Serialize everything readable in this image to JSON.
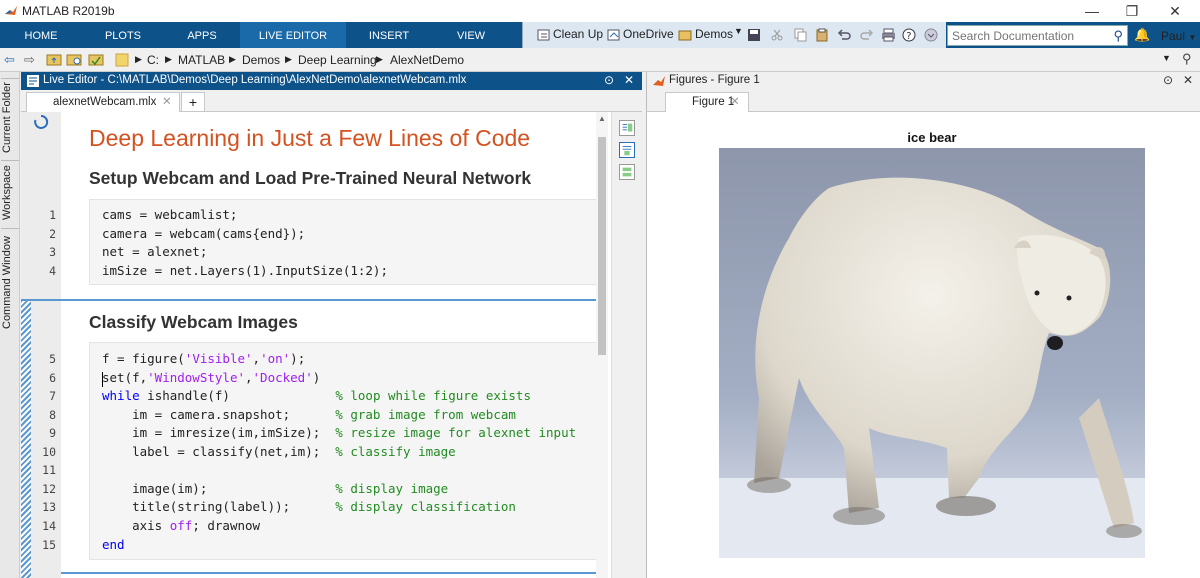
{
  "app": {
    "title": "MATLAB R2019b"
  },
  "window_controls": {
    "minimize": "—",
    "restore": "❐",
    "close": "✕"
  },
  "ribbon": {
    "tabs": [
      "HOME",
      "PLOTS",
      "APPS",
      "LIVE EDITOR",
      "INSERT",
      "VIEW"
    ],
    "active_tab": "LIVE EDITOR",
    "quick_access": {
      "clean_up": "Clean Up",
      "onedrive": "OneDrive",
      "demos": "Demos"
    },
    "search_placeholder": "Search Documentation",
    "user": "Paul"
  },
  "address": {
    "crumbs": [
      "C:",
      "MATLAB",
      "Demos",
      "Deep Learning",
      "AlexNetDemo"
    ]
  },
  "side_tabs": [
    "Current Folder",
    "Workspace",
    "Command Window"
  ],
  "live_editor": {
    "header": "Live Editor - C:\\MATLAB\\Demos\\Deep Learning\\AlexNetDemo\\alexnetWebcam.mlx",
    "file_tab": "alexnetWebcam.mlx",
    "add_tab": "+",
    "heading1": "Deep Learning in Just a Few Lines of Code",
    "section1_title": "Setup Webcam and Load Pre-Trained Neural Network",
    "section2_title": "Classify Webcam Images",
    "line_numbers": [
      "1",
      "2",
      "3",
      "4",
      "5",
      "6",
      "7",
      "8",
      "9",
      "10",
      "11",
      "12",
      "13",
      "14",
      "15"
    ],
    "code": {
      "l1": "cams = webcamlist;",
      "l2": "camera = webcam(cams{end});",
      "l3": "net = alexnet;",
      "l4": "imSize = net.Layers(1).InputSize(1:2);",
      "l5a": "f = figure(",
      "l5b": "'Visible'",
      "l5c": ",",
      "l5d": "'on'",
      "l5e": ");",
      "l6a": "set(f,",
      "l6b": "'WindowStyle'",
      "l6c": ",",
      "l6d": "'Docked'",
      "l6e": ")",
      "l7a": "while",
      "l7b": " ishandle(f)              ",
      "l7c": "% loop while figure exists",
      "l8a": "    im = camera.snapshot;      ",
      "l8b": "% grab image from webcam",
      "l9a": "    im = imresize(im,imSize);  ",
      "l9b": "% resize image for alexnet input",
      "l10a": "    label = classify(net,im);  ",
      "l10b": "% classify image",
      "l11": "",
      "l12a": "    image(im);                 ",
      "l12b": "% display image",
      "l13a": "    title(string(label));      ",
      "l13b": "% display classification",
      "l14a": "    axis ",
      "l14b": "off",
      "l14c": "; drawnow",
      "l15": "end"
    }
  },
  "figures": {
    "header": "Figures - Figure 1",
    "tab": "Figure 1",
    "plot_title": "ice bear"
  },
  "colors": {
    "ribbon": "#0d5289",
    "heading": "#d45220",
    "keyword": "#0000ff",
    "string": "#a020f0",
    "comment": "#228b22"
  }
}
